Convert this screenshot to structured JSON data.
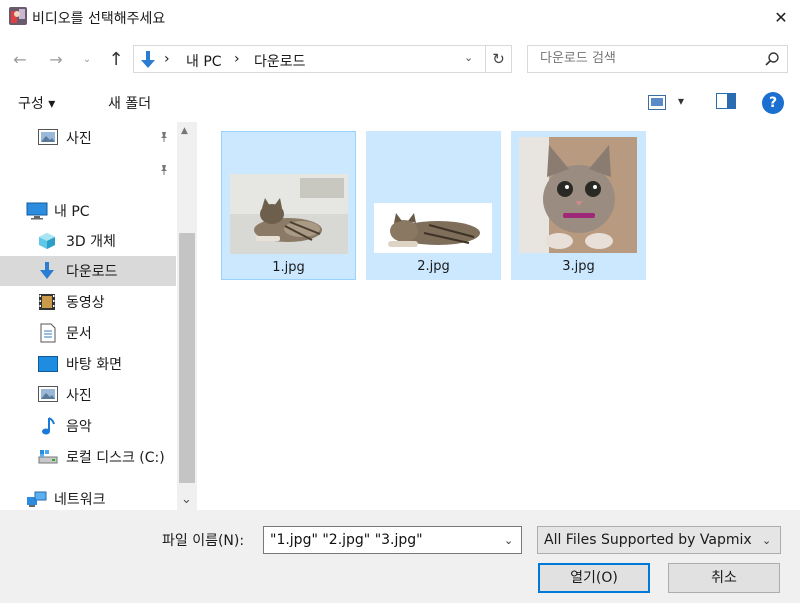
{
  "window": {
    "title": "비디오를 선택해주세요",
    "close_glyph": "✕"
  },
  "nav": {
    "back_glyph": "←",
    "forward_glyph": "→",
    "recent_glyph": "⌄",
    "up_glyph": "↑"
  },
  "address": {
    "sep": "›",
    "crumbs": [
      "내 PC",
      "다운로드"
    ],
    "dropdown_glyph": "⌄",
    "refresh_glyph": "↻"
  },
  "search": {
    "placeholder": "다운로드 검색"
  },
  "toolbar": {
    "organize_label": "구성 ▾",
    "new_folder_label": "새 폴더",
    "view_dd_glyph": "▾",
    "help_label": "?"
  },
  "sidebar": {
    "items": [
      {
        "label": "사진",
        "icon": "pictures-icon"
      },
      {
        "label": "내 PC",
        "icon": "pc-icon"
      },
      {
        "label": "3D 개체",
        "icon": "3d-objects-icon"
      },
      {
        "label": "다운로드",
        "icon": "downloads-icon"
      },
      {
        "label": "동영상",
        "icon": "videos-icon"
      },
      {
        "label": "문서",
        "icon": "documents-icon"
      },
      {
        "label": "바탕 화면",
        "icon": "desktop-icon"
      },
      {
        "label": "사진",
        "icon": "pictures-icon"
      },
      {
        "label": "음악",
        "icon": "music-icon"
      },
      {
        "label": "로컬 디스크 (C:)",
        "icon": "drive-icon"
      },
      {
        "label": "네트워크",
        "icon": "network-icon"
      }
    ],
    "pin_glyph": "📌",
    "scroll_up_glyph": "▲",
    "scroll_down_glyph": "⌄"
  },
  "files": [
    {
      "name": "1.jpg"
    },
    {
      "name": "2.jpg"
    },
    {
      "name": "3.jpg"
    }
  ],
  "bottom": {
    "filename_label": "파일 이름(N):",
    "filename_value": "\"1.jpg\" \"2.jpg\" \"3.jpg\"",
    "filename_dd": "⌄",
    "filter_label": "All Files Supported by Vapmix",
    "filter_dd": "⌄",
    "open_label": "열기(O)",
    "cancel_label": "취소"
  },
  "colors": {
    "selection": "#cce8ff",
    "accent": "#0078d7",
    "help": "#1a6fd0"
  }
}
